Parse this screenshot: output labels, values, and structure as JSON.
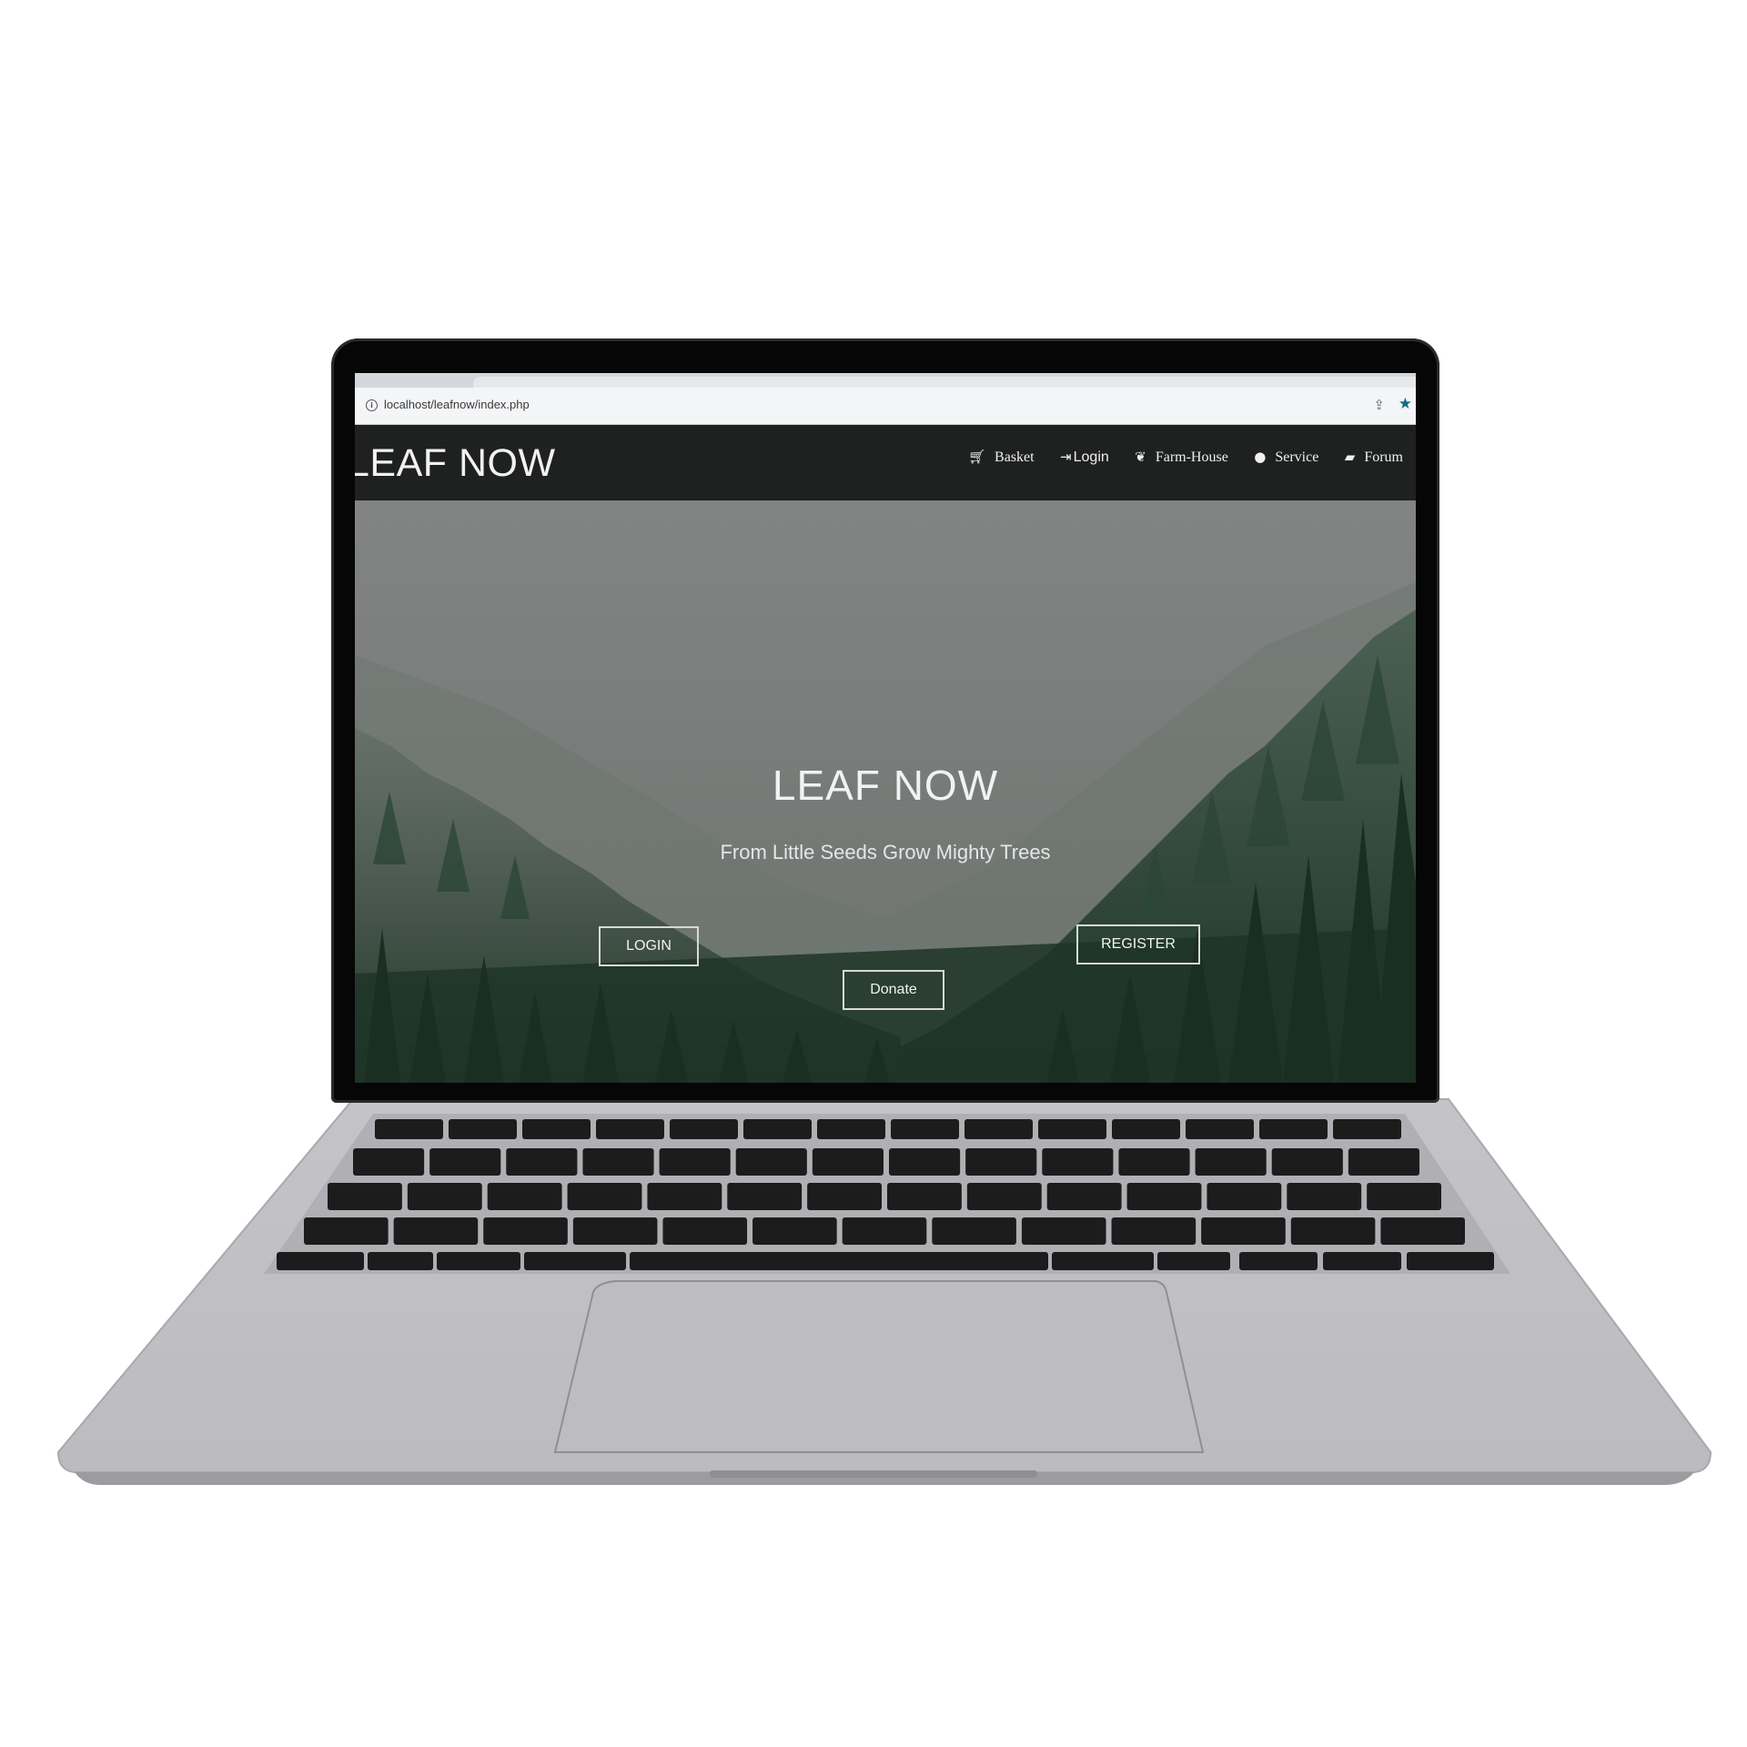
{
  "browser": {
    "url": "localhost/leafnow/index.php"
  },
  "navbar": {
    "brand": "LEAF NOW",
    "items": [
      {
        "label": "Basket",
        "icon": "cart-icon"
      },
      {
        "label": "Login",
        "icon": "login-icon"
      },
      {
        "label": "Farm-House",
        "icon": "leaf-icon"
      },
      {
        "label": "Service",
        "icon": "drop-icon"
      },
      {
        "label": "Forum",
        "icon": "comment-icon"
      }
    ]
  },
  "hero": {
    "title": "LEAF NOW",
    "subtitle": "From Little Seeds Grow Mighty Trees",
    "login_label": "LOGIN",
    "register_label": "REGISTER",
    "donate_label": "Donate"
  },
  "colors": {
    "navbar_bg": "#1f2120",
    "forest_dark": "#1f3527",
    "mist": "#808281",
    "accent_star": "#0e6e86"
  }
}
